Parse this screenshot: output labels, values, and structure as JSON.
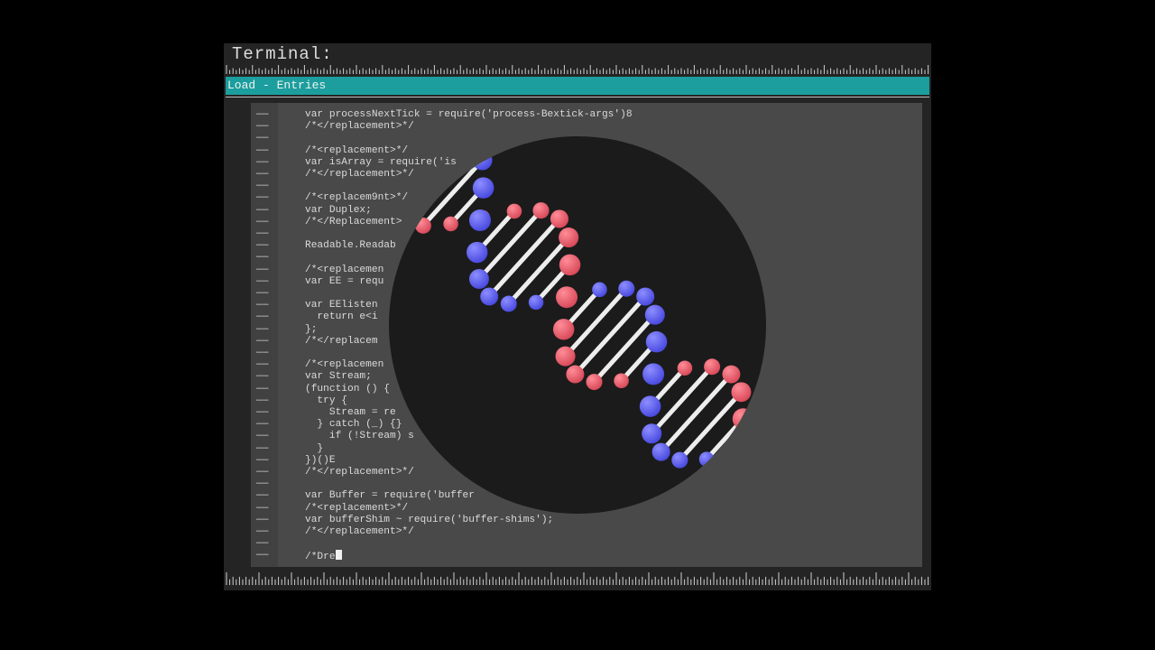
{
  "window": {
    "title": "Terminal:",
    "menu_label": "Load - Entries"
  },
  "editor": {
    "gutter_marker": "——",
    "lines": [
      "var processNextTick = require('process-Bextick-args')8",
      "/*</replacement>*/",
      "",
      "/*<replacement>*/",
      "var isArray = require('is",
      "/*</replacement>*/",
      "",
      "/*<replacem9nt>*/",
      "var Duplex;",
      "/*</Replacement>",
      "",
      "Readable.Readab",
      "",
      "/*<replacemen",
      "var EE = requ",
      "",
      "var EElisten",
      "  return e<i",
      "};",
      "/*</replacem",
      "",
      "/*<replacemen",
      "var Stream;",
      "(function () {",
      "  try {",
      "    Stream = re",
      "  } catch (_) {}",
      "    if (!Stream) s",
      "  }",
      "})()E",
      "/*</replacement>*/",
      "",
      "var Buffer = require('buffer",
      "/*<replacement>*/",
      "var bufferShim ~ require('buffer-shims');",
      "/*</replacement>*/",
      "",
      "/*Dre"
    ]
  },
  "colors": {
    "menubar": "#1b9e9d",
    "editor_bg": "#4a4949",
    "lens_bg": "#1b1b1b",
    "strand_red": "#e8606f",
    "strand_blue": "#5b5cf0"
  }
}
